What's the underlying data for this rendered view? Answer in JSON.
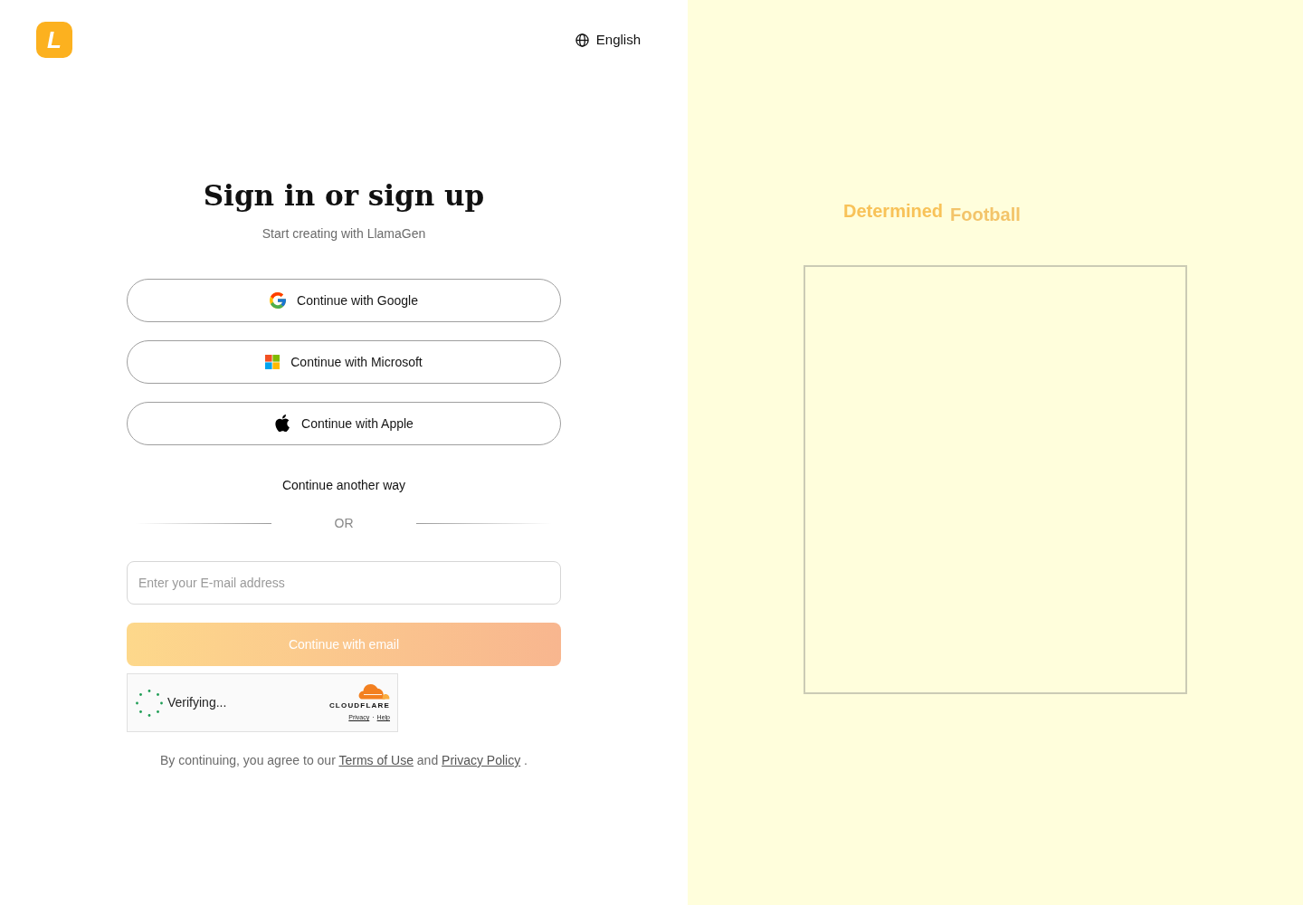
{
  "header": {
    "logo_letter": "L",
    "language": "English"
  },
  "heading": {
    "title": "Sign in or sign up",
    "subtitle": "Start creating with LlamaGen"
  },
  "providers": [
    {
      "kind": "google",
      "label": "Continue with Google"
    },
    {
      "kind": "microsoft",
      "label": "Continue with Microsoft"
    },
    {
      "kind": "apple",
      "label": "Continue with Apple"
    }
  ],
  "another_way": "Continue another way",
  "divider": "OR",
  "email": {
    "placeholder": "Enter your E-mail address"
  },
  "submit": {
    "label": "Continue with email",
    "disabled": true
  },
  "captcha": {
    "status": "Verifying...",
    "brand": "CLOUDFLARE",
    "links": [
      "Privacy",
      "Help"
    ],
    "separator": "·"
  },
  "legal": [
    {
      "kind": "text",
      "text": "By continuing, you agree to our "
    },
    {
      "kind": "link",
      "text": "Terms of Use"
    },
    {
      "kind": "text",
      "text": " and "
    },
    {
      "kind": "link",
      "text": "Privacy Policy"
    },
    {
      "kind": "text",
      "text": " ."
    }
  ],
  "preview": {
    "words": [
      {
        "text": "Determined",
        "color": "#f8c258"
      },
      {
        "text": "Football",
        "color": "#f3c46a"
      }
    ]
  }
}
